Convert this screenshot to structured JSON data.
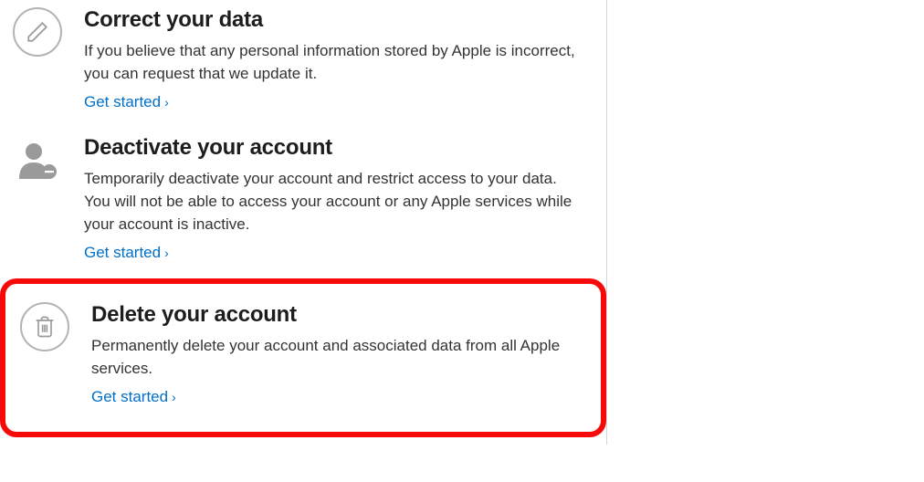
{
  "options": [
    {
      "title": "Correct your data",
      "description": "If you believe that any personal information stored by Apple is incorrect, you can request that we update it.",
      "link": "Get started"
    },
    {
      "title": "Deactivate your account",
      "description": "Temporarily deactivate your account and restrict access to your data. You will not be able to access your account or any Apple services while your account is inactive.",
      "link": "Get started"
    },
    {
      "title": "Delete your account",
      "description": "Permanently delete your account and associated data from all Apple services.",
      "link": "Get started"
    }
  ]
}
